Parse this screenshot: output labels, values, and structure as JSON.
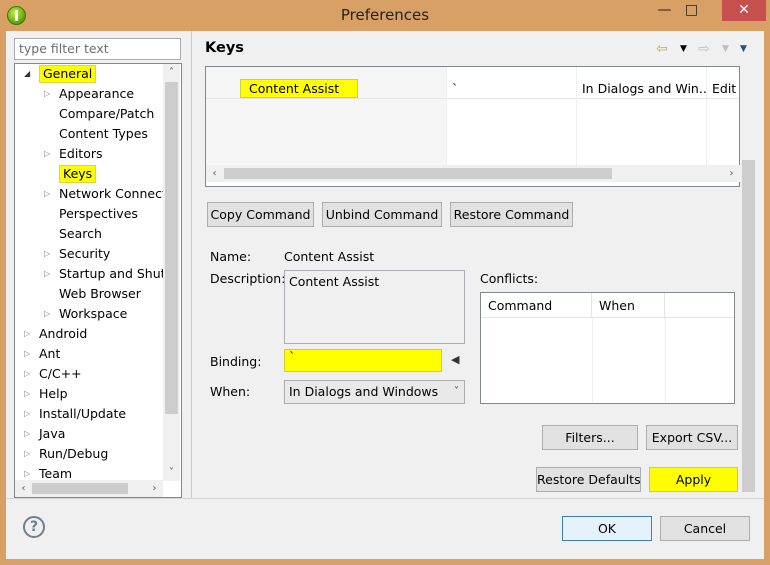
{
  "window": {
    "title": "Preferences"
  },
  "filter": {
    "placeholder": "type filter text"
  },
  "tree": {
    "items": [
      {
        "label": "General",
        "expanded": true,
        "level": 0,
        "highlighted": true
      },
      {
        "label": "Appearance",
        "level": 1,
        "has_children": true
      },
      {
        "label": "Compare/Patch",
        "level": 1
      },
      {
        "label": "Content Types",
        "level": 1
      },
      {
        "label": "Editors",
        "level": 1,
        "has_children": true
      },
      {
        "label": "Keys",
        "level": 1,
        "selected": true,
        "highlighted": true
      },
      {
        "label": "Network Connecti",
        "level": 1,
        "has_children": true
      },
      {
        "label": "Perspectives",
        "level": 1
      },
      {
        "label": "Search",
        "level": 1
      },
      {
        "label": "Security",
        "level": 1,
        "has_children": true
      },
      {
        "label": "Startup and Shutd",
        "level": 1,
        "has_children": true
      },
      {
        "label": "Web Browser",
        "level": 1
      },
      {
        "label": "Workspace",
        "level": 1,
        "has_children": true
      },
      {
        "label": "Android",
        "level": 0,
        "has_children": true
      },
      {
        "label": "Ant",
        "level": 0,
        "has_children": true
      },
      {
        "label": "C/C++",
        "level": 0,
        "has_children": true
      },
      {
        "label": "Help",
        "level": 0,
        "has_children": true
      },
      {
        "label": "Install/Update",
        "level": 0,
        "has_children": true
      },
      {
        "label": "Java",
        "level": 0,
        "has_children": true
      },
      {
        "label": "Run/Debug",
        "level": 0,
        "has_children": true
      },
      {
        "label": "Team",
        "level": 0,
        "has_children": true
      }
    ]
  },
  "page": {
    "title": "Keys"
  },
  "keys_table": {
    "row": {
      "command": "Content Assist",
      "binding": "`",
      "when": "In Dialogs and Win...",
      "category": "Edit"
    }
  },
  "command_buttons": {
    "copy": "Copy Command",
    "unbind": "Unbind Command",
    "restore": "Restore Command"
  },
  "details": {
    "name_label": "Name:",
    "name_value": "Content Assist",
    "description_label": "Description:",
    "description_value": "Content Assist",
    "binding_label": "Binding:",
    "binding_value": "`",
    "when_label": "When:",
    "when_value": "In Dialogs and Windows"
  },
  "conflicts": {
    "label": "Conflicts:",
    "columns": [
      "Command",
      "When"
    ]
  },
  "actions": {
    "filters": "Filters...",
    "export_csv": "Export CSV...",
    "restore_defaults": "Restore Defaults",
    "apply": "Apply"
  },
  "dialog_buttons": {
    "ok": "OK",
    "cancel": "Cancel"
  },
  "colors": {
    "highlight": "#ffff00",
    "title_bar": "#d9a066",
    "close": "#c7504f"
  },
  "icons": {
    "app": "eclipse-icon",
    "back": "arrow-left-icon",
    "forward": "arrow-right-icon",
    "menu": "chevron-down-icon",
    "help": "help-icon"
  }
}
